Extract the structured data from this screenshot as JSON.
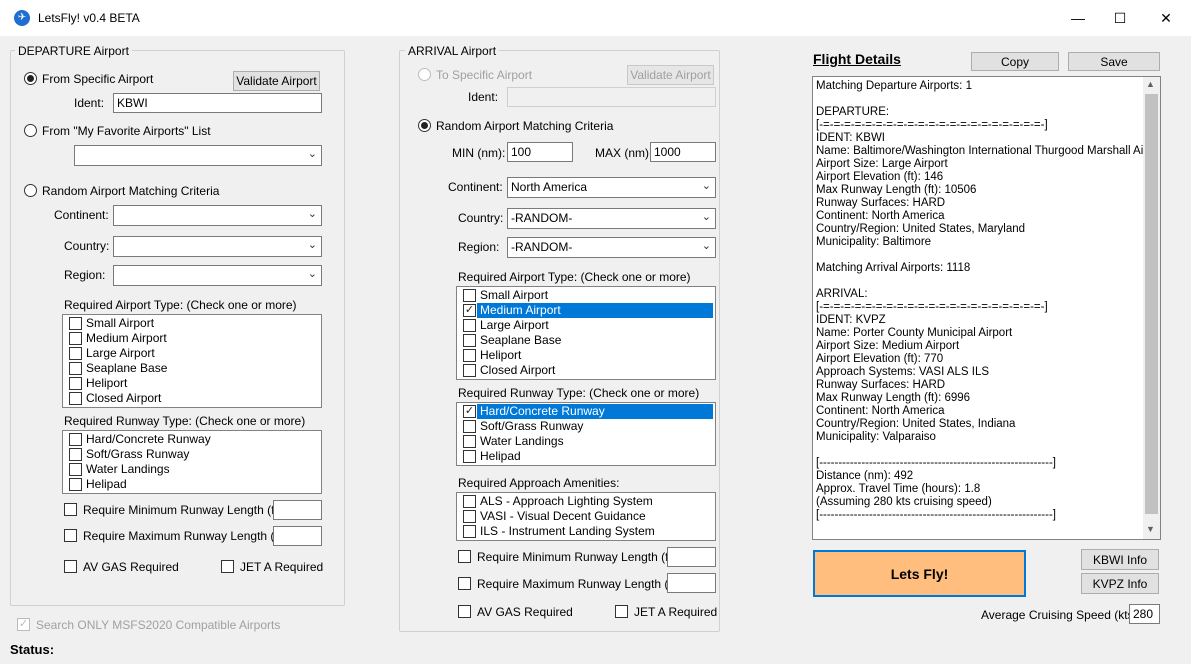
{
  "window": {
    "title": "LetsFly! v0.4 BETA",
    "app_icon": "plane-icon"
  },
  "departure": {
    "group_title": "DEPARTURE Airport",
    "from_specific_label": "From Specific Airport",
    "validate_label": "Validate Airport",
    "ident_label": "Ident:",
    "ident_value": "KBWI",
    "from_favorites_label": "From \"My Favorite Airports\" List",
    "favorites_value": "",
    "random_label": "Random Airport Matching Criteria",
    "continent_label": "Continent:",
    "continent_value": "",
    "country_label": "Country:",
    "country_value": "",
    "region_label": "Region:",
    "region_value": "",
    "airport_type_label": "Required Airport Type:  (Check one or more)",
    "airport_types": [
      {
        "label": "Small Airport",
        "checked": false
      },
      {
        "label": "Medium Airport",
        "checked": false
      },
      {
        "label": "Large Airport",
        "checked": false
      },
      {
        "label": "Seaplane Base",
        "checked": false
      },
      {
        "label": "Heliport",
        "checked": false
      },
      {
        "label": "Closed Airport",
        "checked": false
      }
    ],
    "runway_type_label": "Required Runway Type:  (Check one or more)",
    "runway_types": [
      {
        "label": "Hard/Concrete Runway",
        "checked": false
      },
      {
        "label": "Soft/Grass Runway",
        "checked": false
      },
      {
        "label": "Water Landings",
        "checked": false
      },
      {
        "label": "Helipad",
        "checked": false
      }
    ],
    "min_runway_label": "Require Minimum Runway Length (ft):",
    "max_runway_label": "Require Maximum Runway Length (ft):",
    "avgas_label": "AV GAS Required",
    "jeta_label": "JET A Required"
  },
  "search_msfs_label": "Search ONLY MSFS2020 Compatible Airports",
  "status_label": "Status:",
  "arrival": {
    "group_title": "ARRIVAL Airport",
    "to_specific_label": "To Specific Airport",
    "validate_label": "Validate Airport",
    "ident_label": "Ident:",
    "ident_value": "",
    "random_label": "Random Airport Matching Criteria",
    "min_label": "MIN (nm):",
    "min_value": "100",
    "max_label": "MAX (nm)",
    "max_value": "1000",
    "continent_label": "Continent:",
    "continent_value": "North America",
    "country_label": "Country:",
    "country_value": "-RANDOM-",
    "region_label": "Region:",
    "region_value": "-RANDOM-",
    "airport_type_label": "Required Airport Type:  (Check one or more)",
    "airport_types": [
      {
        "label": "Small Airport",
        "checked": false
      },
      {
        "label": "Medium Airport",
        "checked": true
      },
      {
        "label": "Large Airport",
        "checked": false
      },
      {
        "label": "Seaplane Base",
        "checked": false
      },
      {
        "label": "Heliport",
        "checked": false
      },
      {
        "label": "Closed Airport",
        "checked": false
      }
    ],
    "runway_type_label": "Required Runway Type:  (Check one or more)",
    "runway_types": [
      {
        "label": "Hard/Concrete Runway",
        "checked": true
      },
      {
        "label": "Soft/Grass Runway",
        "checked": false
      },
      {
        "label": "Water Landings",
        "checked": false
      },
      {
        "label": "Helipad",
        "checked": false
      }
    ],
    "approach_label": "Required Approach Amenities:",
    "approach_items": [
      {
        "label": "ALS - Approach Lighting System",
        "checked": false
      },
      {
        "label": "VASI - Visual Decent Guidance",
        "checked": false
      },
      {
        "label": "ILS - Instrument Landing System",
        "checked": false
      }
    ],
    "min_runway_label": "Require Minimum Runway Length (ft):",
    "max_runway_label": "Require Maximum Runway Length (ft):",
    "avgas_label": "AV GAS Required",
    "jeta_label": "JET A Required"
  },
  "details": {
    "title": "Flight Details",
    "copy_label": "Copy",
    "save_label": "Save",
    "lines": [
      "Matching Departure Airports:  1",
      "",
      "DEPARTURE:",
      "[-=-=-=-=-=-=-=-=-=-=-=-=-=-=-=-=-=-=-=-=-=-]",
      "IDENT: KBWI",
      "Name: Baltimore/Washington International Thurgood Marshall Airport",
      "Airport Size: Large Airport",
      "Airport Elevation (ft): 146",
      "Max Runway Length (ft): 10506",
      "Runway Surfaces: HARD",
      "Continent: North America",
      "Country/Region: United States, Maryland",
      "Municipality: Baltimore",
      "",
      "Matching Arrival Airports:  1118",
      "",
      "ARRIVAL:",
      "[-=-=-=-=-=-=-=-=-=-=-=-=-=-=-=-=-=-=-=-=-=-]",
      "IDENT: KVPZ",
      "Name: Porter County Municipal Airport",
      "Airport Size: Medium Airport",
      "Airport Elevation (ft): 770",
      "Approach Systems: VASI ALS ILS",
      "Runway Surfaces: HARD",
      "Max Runway Length (ft): 6996",
      "Continent: North America",
      "Country/Region: United States, Indiana",
      "Municipality: Valparaiso",
      "",
      "[-------------------------------------------------------------]",
      "Distance (nm): 492",
      "Approx. Travel Time (hours): 1.8",
      "(Assuming 280 kts cruising speed)",
      "[-------------------------------------------------------------]"
    ],
    "letsfly_label": "Lets Fly!",
    "kbwi_info_label": "KBWI Info",
    "kvpz_info_label": "KVPZ Info",
    "cruise_label": "Average Cruising Speed (kts):",
    "cruise_value": "280"
  }
}
